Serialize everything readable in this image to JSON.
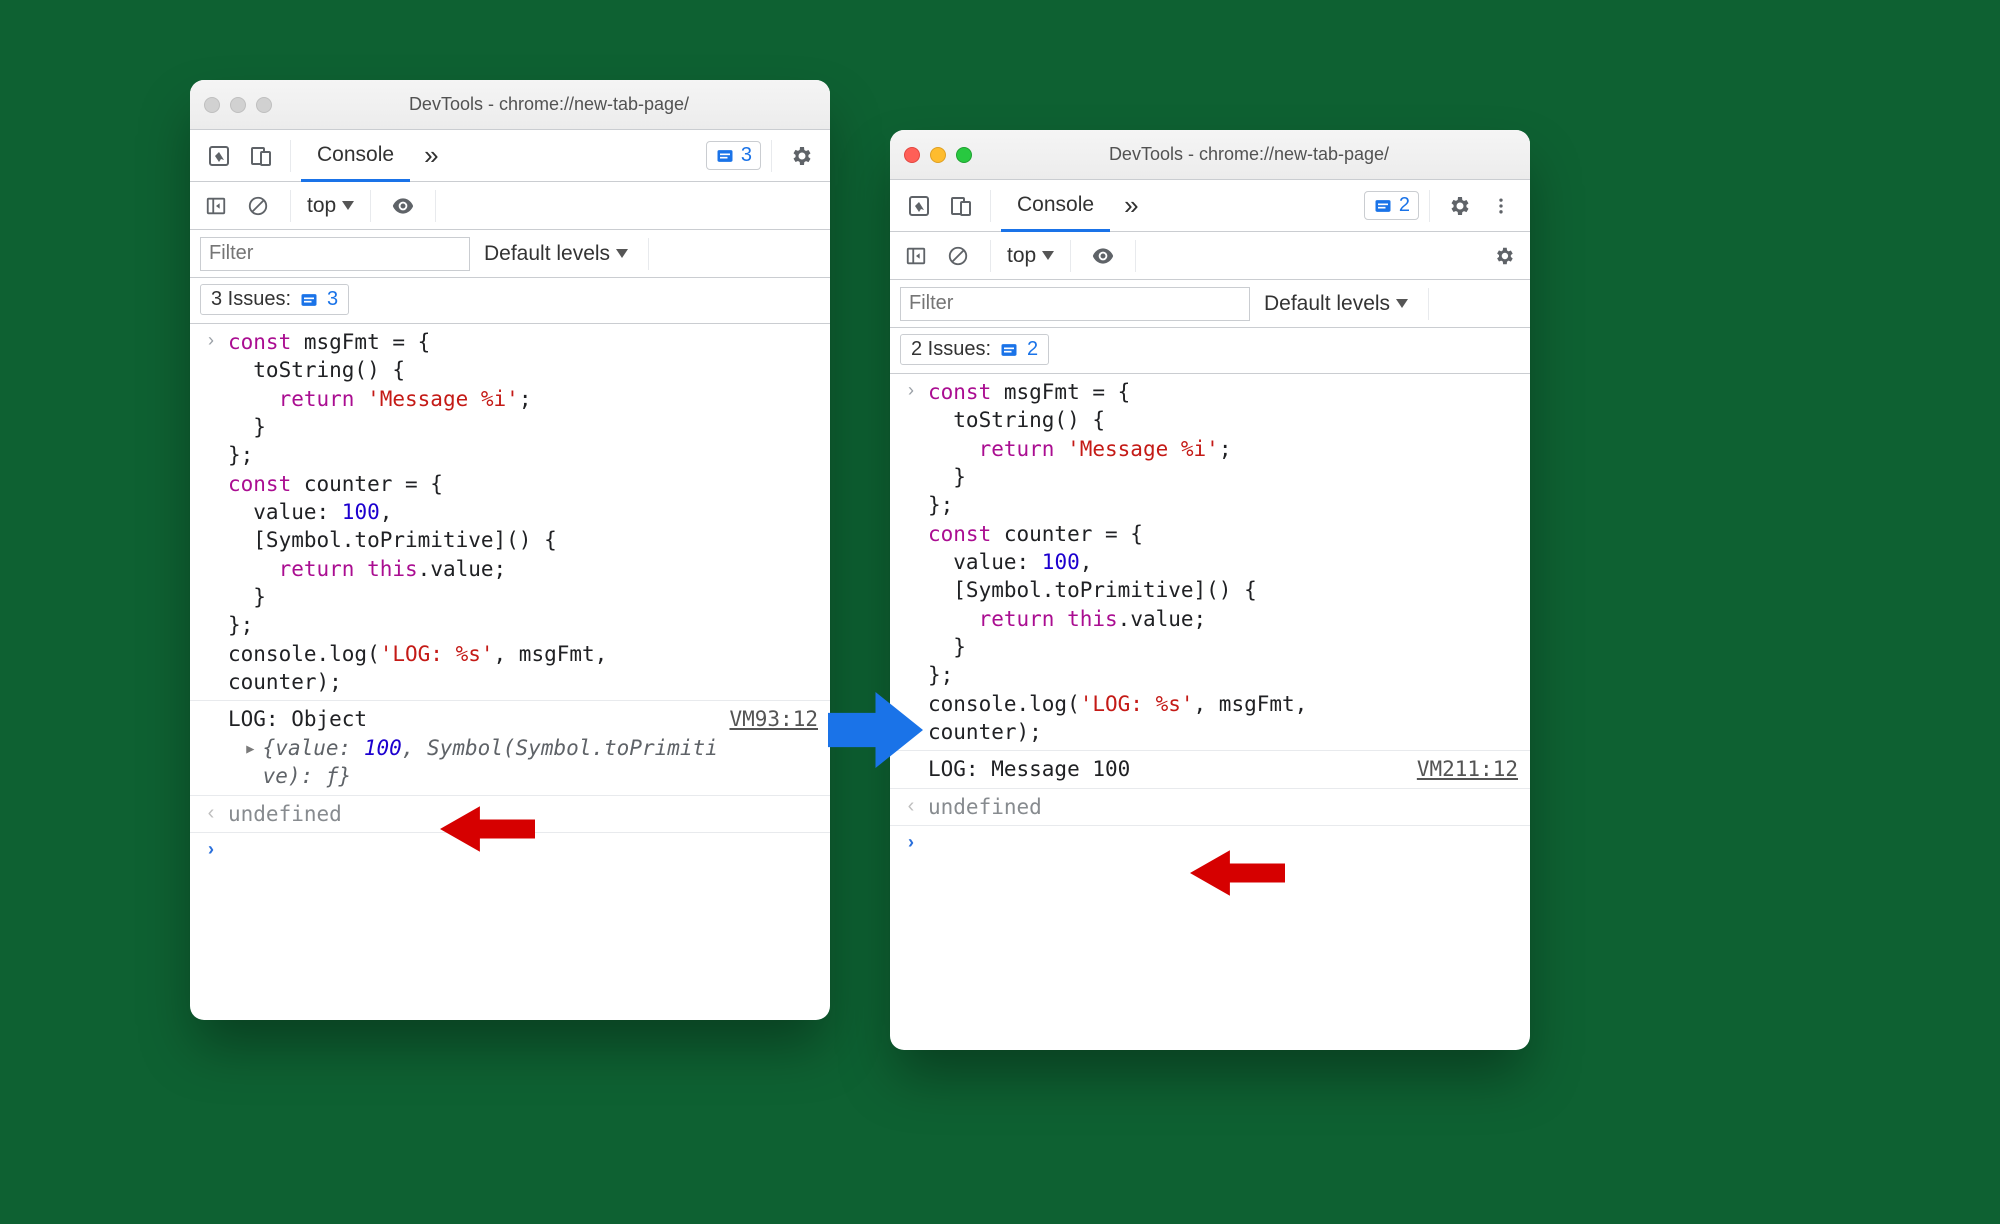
{
  "leftWindow": {
    "title": "DevTools - chrome://new-tab-page/",
    "tabs": {
      "console": "Console"
    },
    "issueBadgeCount": "3",
    "context": "top",
    "filterPlaceholder": "Filter",
    "defaultLevels": "Default levels",
    "issuesLabel": "3 Issues:",
    "issuesCount": "3",
    "logOutput": "LOG: Object",
    "sourceLink": "VM93:12",
    "objectPreview": "{value: 100, Symbol(Symbol.toPrimitive): ƒ}",
    "undefined": "undefined"
  },
  "rightWindow": {
    "title": "DevTools - chrome://new-tab-page/",
    "tabs": {
      "console": "Console"
    },
    "issueBadgeCount": "2",
    "context": "top",
    "filterPlaceholder": "Filter",
    "defaultLevels": "Default levels",
    "issuesLabel": "2 Issues:",
    "issuesCount": "2",
    "logOutput": "LOG: Message 100",
    "sourceLink": "VM211:12",
    "undefined": "undefined"
  },
  "code": {
    "l1a": "const",
    "l1b": " msgFmt = {",
    "l2": "  toString() {",
    "l3a": "    ",
    "l3b": "return",
    "l3c": " ",
    "l3d": "'Message %i'",
    "l3e": ";",
    "l4": "  }",
    "l5": "};",
    "l6a": "const",
    "l6b": " counter = {",
    "l7a": "  value: ",
    "l7b": "100",
    "l7c": ",",
    "l8": "  [Symbol.toPrimitive]() {",
    "l9a": "    ",
    "l9b": "return",
    "l9c": " ",
    "l9d": "this",
    "l9e": ".value;",
    "l10": "  }",
    "l11": "};",
    "l12a": "console.log(",
    "l12b": "'LOG: %s'",
    "l12c": ", msgFmt,",
    "l13": "counter);"
  }
}
